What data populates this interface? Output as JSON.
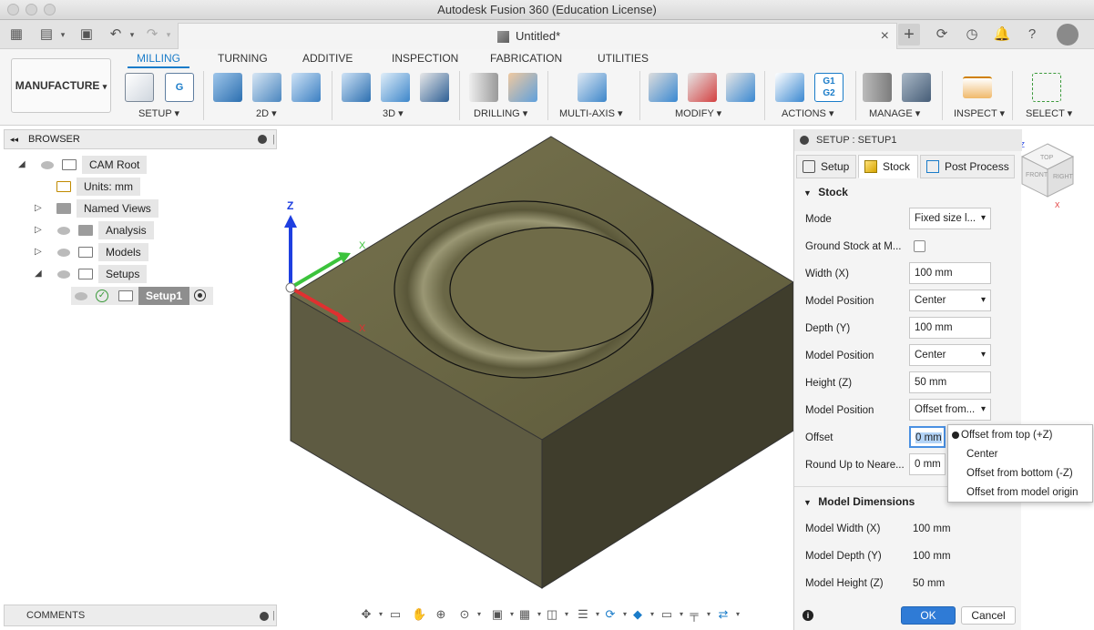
{
  "window": {
    "title": "Autodesk Fusion 360 (Education License)"
  },
  "document": {
    "tab_name": "Untitled*"
  },
  "ribbon": {
    "workspace": "MANUFACTURE",
    "tabs": [
      "MILLING",
      "TURNING",
      "ADDITIVE",
      "INSPECTION",
      "FABRICATION",
      "UTILITIES"
    ],
    "active_tab": "MILLING",
    "groups": [
      "SETUP ▾",
      "2D ▾",
      "3D ▾",
      "DRILLING ▾",
      "MULTI-AXIS ▾",
      "MODIFY ▾",
      "ACTIONS ▾",
      "MANAGE ▾",
      "INSPECT ▾",
      "SELECT ▾"
    ],
    "gcode_icon_label": "G1\nG2"
  },
  "browser": {
    "title": "BROWSER",
    "items": [
      {
        "label": "CAM Root"
      },
      {
        "label": "Units: mm"
      },
      {
        "label": "Named Views"
      },
      {
        "label": "Analysis"
      },
      {
        "label": "Models"
      },
      {
        "label": "Setups"
      },
      {
        "label": "Setup1"
      }
    ]
  },
  "comments": {
    "title": "COMMENTS"
  },
  "setup_panel": {
    "title": "SETUP : SETUP1",
    "tabs": [
      "Setup",
      "Stock",
      "Post Process"
    ],
    "active_tab": "Stock",
    "stock_section": "Stock",
    "props": {
      "mode_label": "Mode",
      "mode_value": "Fixed size l...",
      "ground_label": "Ground Stock at M...",
      "width_label": "Width (X)",
      "width_value": "100 mm",
      "pos1_label": "Model Position",
      "pos1_value": "Center",
      "depth_label": "Depth (Y)",
      "depth_value": "100 mm",
      "pos2_label": "Model Position",
      "pos2_value": "Center",
      "height_label": "Height (Z)",
      "height_value": "50 mm",
      "pos3_label": "Model Position",
      "pos3_value": "Offset from...",
      "offset_label": "Offset",
      "offset_value": "0 mm",
      "round_label": "Round Up to Neare...",
      "round_value": "0 mm"
    },
    "model_dims_section": "Model Dimensions",
    "model_dims": {
      "mw_label": "Model Width (X)",
      "mw_value": "100 mm",
      "md_label": "Model Depth (Y)",
      "md_value": "100 mm",
      "mh_label": "Model Height (Z)",
      "mh_value": "50 mm"
    },
    "ok": "OK",
    "cancel": "Cancel"
  },
  "position_dropdown": {
    "options": [
      "Offset from top (+Z)",
      "Center",
      "Offset from bottom (-Z)",
      "Offset from model origin"
    ],
    "selected": "Offset from top (+Z)"
  },
  "viewport": {
    "axis_z": "Z",
    "axis_x": "X",
    "axis_y": "Y",
    "stock_color": "#6a6644"
  },
  "viewcube": {
    "top": "TOP",
    "front": "FRONT",
    "right": "RIGHT",
    "z": "Z",
    "x": "X"
  },
  "colors": {
    "accent": "#1a7cc9",
    "ok_button": "#2f7bd6"
  }
}
